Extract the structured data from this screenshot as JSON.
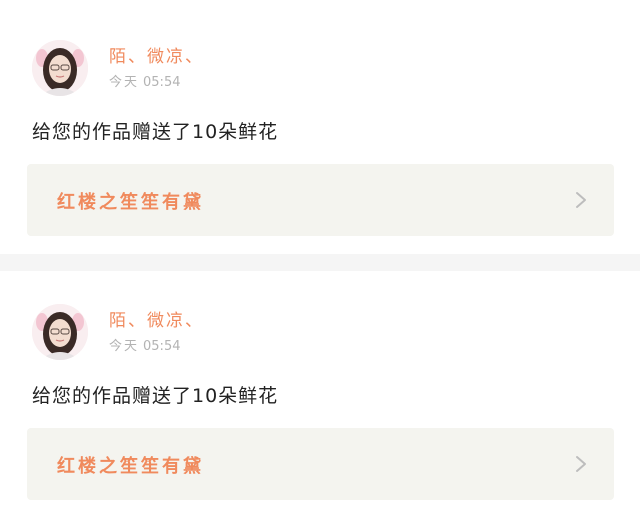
{
  "notifications": [
    {
      "user_name": "陌、微凉、",
      "time_day": "今天",
      "time_clock": "05:54",
      "message": "给您的作品赠送了10朵鲜花",
      "work_title": "红楼之笙笙有黛",
      "icon": "chevron-right-icon"
    },
    {
      "user_name": "陌、微凉、",
      "time_day": "今天",
      "time_clock": "05:54",
      "message": "给您的作品赠送了10朵鲜花",
      "work_title": "红楼之笙笙有黛",
      "icon": "chevron-right-icon"
    }
  ],
  "colors": {
    "accent": "#f08a5d",
    "meta_text": "#b3b3b3",
    "link_bg": "#f4f4ef",
    "divider": "#f5f5f5"
  }
}
